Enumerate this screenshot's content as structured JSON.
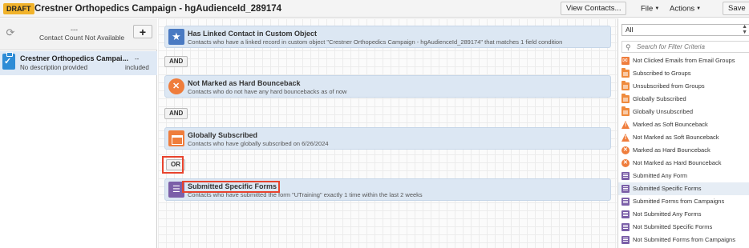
{
  "header": {
    "status_badge": "DRAFT",
    "title": "Crestner Orthopedics Campaign - hgAudienceId_289174",
    "view_contacts_label": "View Contacts...",
    "file_menu_label": "File",
    "actions_menu_label": "Actions",
    "save_label": "Save"
  },
  "left_panel": {
    "count_value": "---",
    "count_label": "Contact Count Not Available",
    "segment": {
      "name": "Crestner Orthopedics Campai...",
      "description": "No description provided",
      "count": "--",
      "status": "included"
    }
  },
  "canvas": {
    "blocks": [
      {
        "name": "Has Linked Contact in Custom Object",
        "description": "Contacts who have a linked record in custom object \"Crestner Orthopedics Campaign - hgAudienceId_289174\" that matches 1 field condition",
        "icon": "star-icon"
      },
      {
        "name": "Not Marked as Hard Bounceback",
        "description": "Contacts who do not have any hard bouncebacks as of now",
        "icon": "x-circle-icon"
      },
      {
        "name": "Globally Subscribed",
        "description": "Contacts who have globally subscribed on 6/26/2024",
        "icon": "envelope-icon"
      },
      {
        "name": "Submitted Specific Forms",
        "description": "Contacts who have submitted the form \"UTraining\" exactly 1 time within the last 2 weeks",
        "icon": "form-icon"
      }
    ],
    "connectors": [
      "AND",
      "AND",
      "OR"
    ]
  },
  "right_panel": {
    "filter_select_value": "All",
    "search_placeholder": "Search for Filter Criteria",
    "criteria": [
      {
        "label": "Not Clicked Emails from Email Groups",
        "icon": "email-group-icon"
      },
      {
        "label": "Subscribed to Groups",
        "icon": "folder-icon"
      },
      {
        "label": "Unsubscribed from Groups",
        "icon": "folder-icon"
      },
      {
        "label": "Globally Subscribed",
        "icon": "folder-icon"
      },
      {
        "label": "Globally Unsubscribed",
        "icon": "folder-icon"
      },
      {
        "label": "Marked as Soft Bounceback",
        "icon": "warning-icon"
      },
      {
        "label": "Not Marked as Soft Bounceback",
        "icon": "warning-icon"
      },
      {
        "label": "Marked as Hard Bounceback",
        "icon": "x-circle-icon"
      },
      {
        "label": "Not Marked as Hard Bounceback",
        "icon": "x-circle-icon"
      },
      {
        "label": "Submitted Any Form",
        "icon": "form-icon"
      },
      {
        "label": "Submitted Specific Forms",
        "icon": "form-icon",
        "selected": true
      },
      {
        "label": "Submitted Forms from Campaigns",
        "icon": "form-icon"
      },
      {
        "label": "Not Submitted Any Forms",
        "icon": "form-icon"
      },
      {
        "label": "Not Submitted Specific Forms",
        "icon": "form-icon"
      },
      {
        "label": "Not Submitted Forms from Campaigns",
        "icon": "form-icon"
      }
    ]
  },
  "colors": {
    "accent": "#e8432d",
    "draft_badge": "#f1b32b",
    "block_bg": "#dce7f3",
    "orange_icon": "#ef7d3c",
    "purple_icon": "#7b5fa8"
  }
}
